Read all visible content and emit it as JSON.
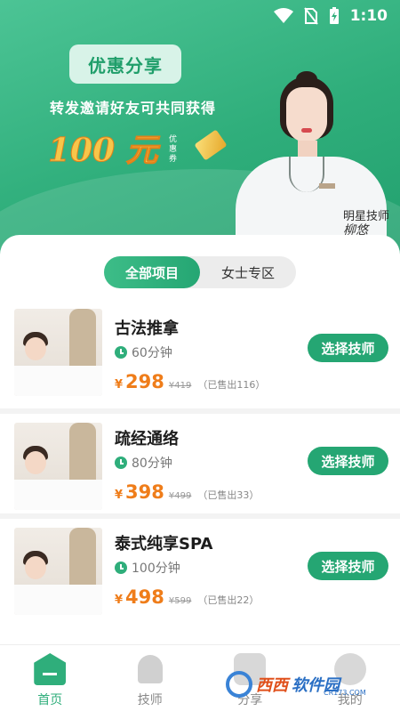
{
  "status_bar": {
    "time": "1:10"
  },
  "banner": {
    "pill": "优惠分享",
    "subtitle": "转发邀请好友可共同获得",
    "amount": "100 元",
    "unit": "优惠券",
    "star_tech": "明星技师",
    "signature": "柳悠"
  },
  "tabs": [
    {
      "label": "全部项目",
      "active": true
    },
    {
      "label": "女士专区",
      "active": false
    }
  ],
  "services": [
    {
      "title": "古法推拿",
      "duration": "60分钟",
      "currency": "¥",
      "price": "298",
      "original": "¥419",
      "sold": "（已售出116）",
      "button": "选择技师"
    },
    {
      "title": "疏经通络",
      "duration": "80分钟",
      "currency": "¥",
      "price": "398",
      "original": "¥499",
      "sold": "（已售出33）",
      "button": "选择技师"
    },
    {
      "title": "泰式纯享SPA",
      "duration": "100分钟",
      "currency": "¥",
      "price": "498",
      "original": "¥599",
      "sold": "（已售出22）",
      "button": "选择技师"
    }
  ],
  "nav": [
    {
      "label": "首页",
      "icon": "home-icon",
      "active": true
    },
    {
      "label": "技师",
      "icon": "technician-icon",
      "active": false
    },
    {
      "label": "分享",
      "icon": "share-icon",
      "active": false
    },
    {
      "label": "我的",
      "icon": "profile-icon",
      "active": false
    }
  ],
  "watermark": {
    "brand": "西西",
    "suffix": "软件园",
    "url": "CR173.COM"
  },
  "colors": {
    "primary": "#2fae7b",
    "price": "#ef7d1a",
    "coupon": "#f7c64a"
  }
}
